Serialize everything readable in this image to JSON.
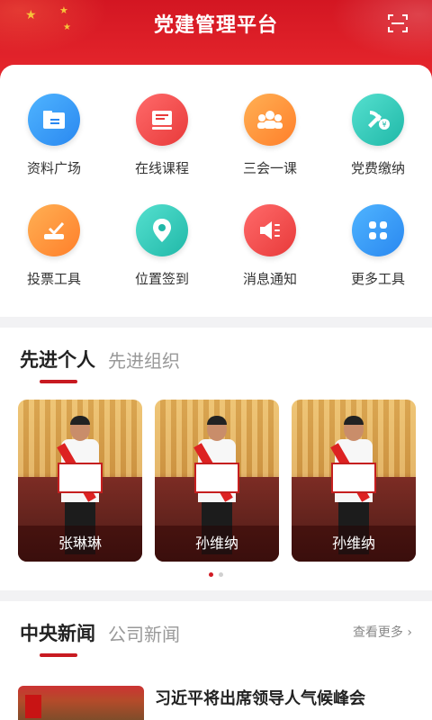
{
  "header": {
    "title": "党建管理平台",
    "scan_icon": "scan-icon"
  },
  "features": [
    {
      "label": "资料广场",
      "icon": "folder-icon",
      "color": "blue"
    },
    {
      "label": "在线课程",
      "icon": "course-icon",
      "color": "red"
    },
    {
      "label": "三会一课",
      "icon": "meeting-icon",
      "color": "orange"
    },
    {
      "label": "党费缴纳",
      "icon": "party-fee-icon",
      "color": "teal"
    },
    {
      "label": "投票工具",
      "icon": "vote-icon",
      "color": "orange"
    },
    {
      "label": "位置签到",
      "icon": "location-icon",
      "color": "teal"
    },
    {
      "label": "消息通知",
      "icon": "notification-icon",
      "color": "red"
    },
    {
      "label": "更多工具",
      "icon": "more-tools-icon",
      "color": "blue"
    }
  ],
  "advanced": {
    "active_tab": "先进个人",
    "other_tab": "先进组织",
    "people": [
      {
        "name": "张琳琳"
      },
      {
        "name": "孙维纳"
      },
      {
        "name": "孙维纳"
      }
    ],
    "pagination": {
      "current": 1,
      "total": 2
    }
  },
  "news": {
    "active_tab": "中央新闻",
    "other_tab": "公司新闻",
    "more_label": "查看更多",
    "items": [
      {
        "title": "习近平将出席领导人气候峰会"
      }
    ]
  },
  "colors": {
    "brand_red": "#d31622",
    "accent_red": "#c81a21"
  }
}
